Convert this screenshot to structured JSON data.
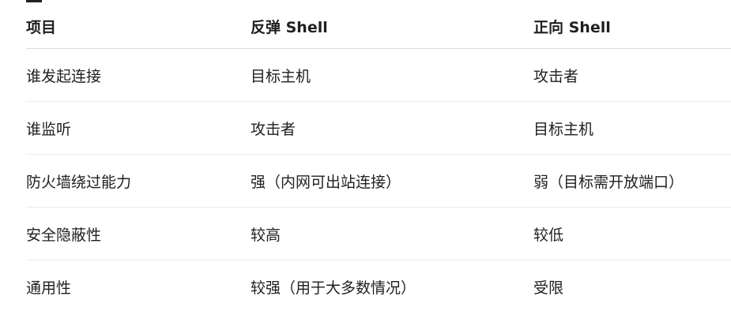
{
  "table": {
    "headers": [
      "项目",
      "反弹 Shell",
      "正向 Shell"
    ],
    "rows": [
      [
        "谁发起连接",
        "目标主机",
        "攻击者"
      ],
      [
        "谁监听",
        "攻击者",
        "目标主机"
      ],
      [
        "防火墙绕过能力",
        "强（内网可出站连接）",
        "弱（目标需开放端口）"
      ],
      [
        "安全隐蔽性",
        "较高",
        "较低"
      ],
      [
        "通用性",
        "较强（用于大多数情况）",
        "受限"
      ]
    ]
  }
}
